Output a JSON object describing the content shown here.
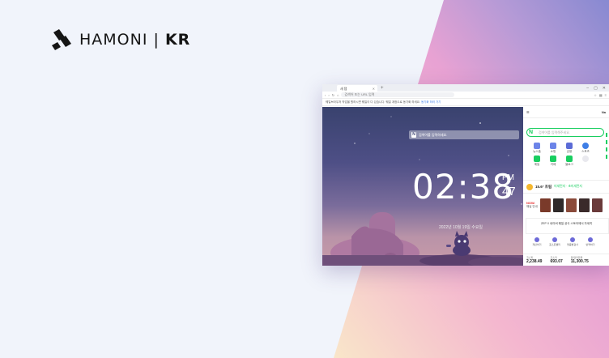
{
  "brand": {
    "name_light": "HAMONI",
    "name_bold": "KR"
  },
  "browser": {
    "tab_label": "새 탭",
    "address_placeholder": "검색어 또는 URL 입력",
    "notice_text": "웨일브라우저 작업을 원하시면 웨일이 다 있습니다. 웨일 계정으로 동기화 하세요.",
    "notice_link": "동기화 하러 가기",
    "page": {
      "search_placeholder": "검색어를 입력하세요.",
      "clock_time": "02:38",
      "clock_ampm": "PM",
      "clock_seconds": "47",
      "date_text": "2022년 10월 19일 수요일"
    },
    "sidebar": {
      "search_placeholder": "검색어를 입력해주세요.",
      "services": [
        {
          "label": "뉴스홈",
          "color": "#6c84e8"
        },
        {
          "label": "쇼핑",
          "color": "#6c84e8"
        },
        {
          "label": "금융",
          "color": "#5b6bd6"
        },
        {
          "label": "스포츠",
          "color": "#3e7ee6"
        },
        {
          "label": "",
          "color": "#ffffff"
        },
        {
          "label": "메일",
          "color": "#19ce60"
        },
        {
          "label": "카페",
          "color": "#19ce60"
        },
        {
          "label": "블로그",
          "color": "#19ce60"
        },
        {
          "label": "",
          "color": "#e9e9ee"
        }
      ],
      "weather_temp": "15.6° 흐림",
      "weather_desc": "미세먼지 · 초미세먼지",
      "media_brand_1": "NOW.",
      "media_brand_2": "채널 안내",
      "posters": [
        "#7a3a2a",
        "#2f2a2a",
        "#8a4a3a",
        "#3a2a2a",
        "#6a3a3a"
      ],
      "banner_text": "ZEP X 네이버 웨일 공식 스토어에서 자세히",
      "tools": [
        "계산하기",
        "포스트밸리",
        "맞춤법검사",
        "번역하기"
      ],
      "stocks": [
        {
          "name": "코스피",
          "value": "2,238.49"
        },
        {
          "name": "코스닥",
          "value": "693.07"
        },
        {
          "name": "원/달러환율",
          "value": "11,300.75"
        }
      ]
    }
  }
}
